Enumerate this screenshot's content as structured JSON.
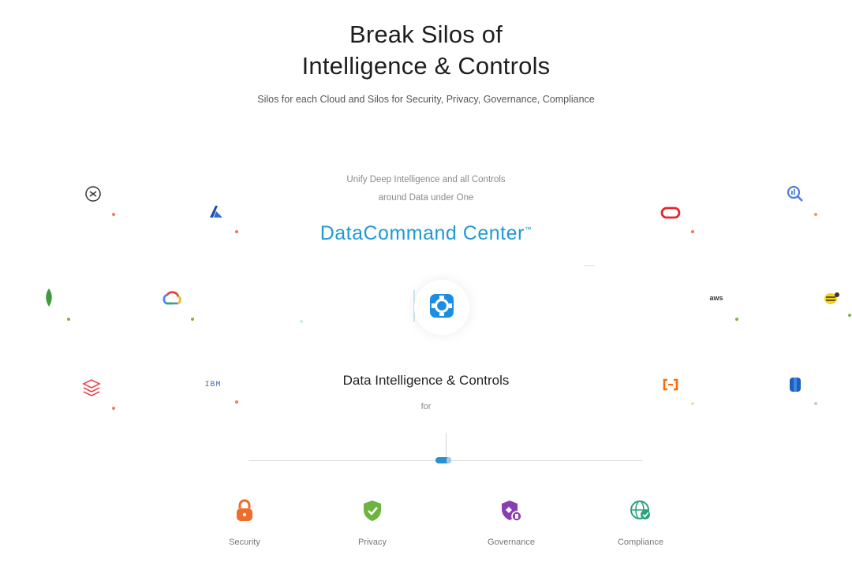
{
  "header": {
    "title_line1": "Break Silos of",
    "title_line2": "Intelligence & Controls",
    "subtitle": "Silos for each Cloud and Silos for Security, Privacy, Governance, Compliance"
  },
  "center": {
    "unify_line1": "Unify Deep Intelligence and all Controls",
    "unify_line2": "around Data under One",
    "brand": "DataCommand Center",
    "brand_mark": "™",
    "hub_icon": "securiti-logo-icon",
    "heading": "Data Intelligence & Controls",
    "for_label": "for",
    "accent_color": "#1f9ad6"
  },
  "platforms": {
    "left": [
      "snowflake-icon",
      "azure-icon",
      "mongodb-icon",
      "google-cloud-icon",
      "databricks-icon",
      "ibm-icon"
    ],
    "right": [
      "oracle-icon",
      "bigquery-icon",
      "aws-icon",
      "hive-icon",
      "alibaba-cloud-icon",
      "db2-icon"
    ],
    "aws_text": "aws",
    "ibm_text": "IBM"
  },
  "controls": [
    {
      "label": "Security",
      "icon": "lock-icon",
      "color": "#ef6c2b"
    },
    {
      "label": "Privacy",
      "icon": "shield-check-icon",
      "color": "#6cb33f"
    },
    {
      "label": "Governance",
      "icon": "governance-shield-icon",
      "color": "#8a3fb0"
    },
    {
      "label": "Compliance",
      "icon": "globe-check-icon",
      "color": "#2aa37c"
    }
  ]
}
